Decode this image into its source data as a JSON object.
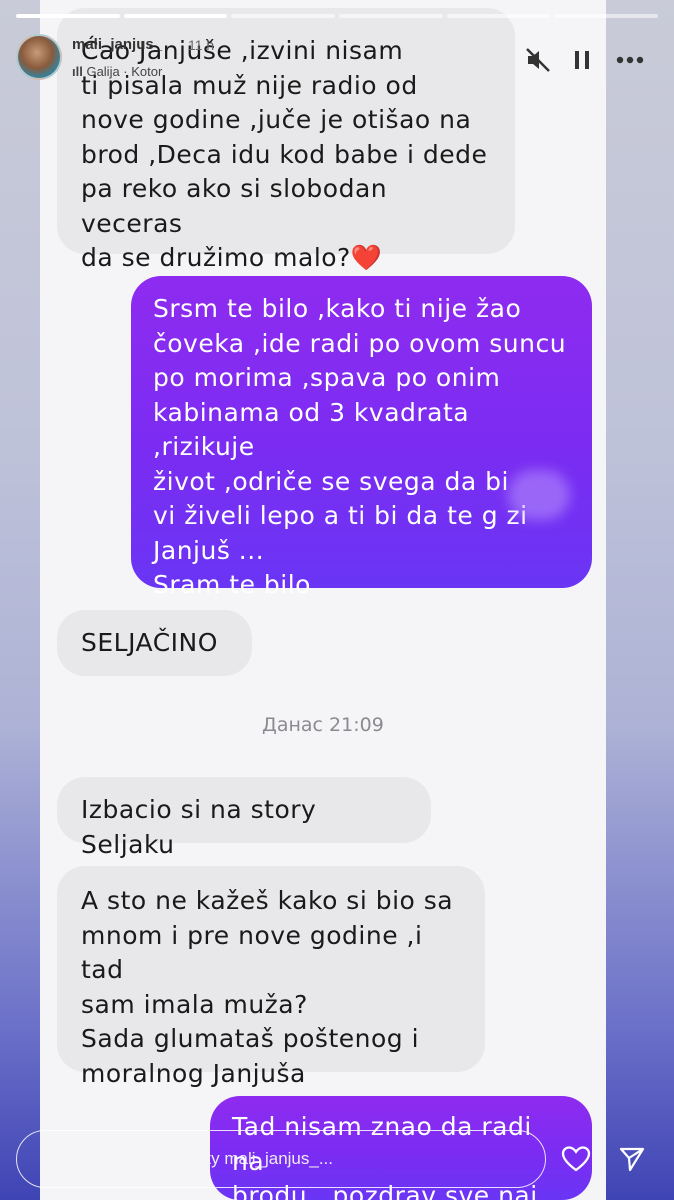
{
  "story": {
    "username": "mali_janjus_",
    "time": "11 h",
    "location": "Galija · Kotor",
    "progress_total": 6,
    "progress_done": 2
  },
  "messages": {
    "m1": "Ćao  Janjuše ,izvini nisam\nti pisala muž nije radio od\nnove godine ,juče je otišao na\nbrod ,Deca idu kod babe i dede\npa reko ako si slobodan veceras\nda se družimo malo?❤️",
    "m2": "Srsm te bilo ,kako ti nije žao\nčoveka ,ide radi po ovom suncu\npo morima ,spava po onim\nkabinama od 3 kvadrata ,rizikuje\nživot ,odriče se svega da bi\nvi živeli lepo a ti bi da te g  zi\nJanjuš ...\nSram te bilo",
    "m3": "SELJAČINO",
    "timestamp": "Данас 21:09",
    "m4": "Izbacio si na story Seljaku",
    "m5": "A sto ne kažeš kako si bio sa\nmnom i pre nove godine ,i tad\nsam imala muža?\nSada glumataš poštenog i\nmoralnog Janjuša",
    "m6": "Tad nisam znao da radi na\nbrodu...pozdrav sve naj"
  },
  "reply": {
    "placeholder": "Одговорите кориснику mali_janjus_..."
  },
  "colors": {
    "outgoing_top": "#8f2bf0",
    "outgoing_bottom": "#6a35f4",
    "incoming": "#e8e8ea"
  }
}
